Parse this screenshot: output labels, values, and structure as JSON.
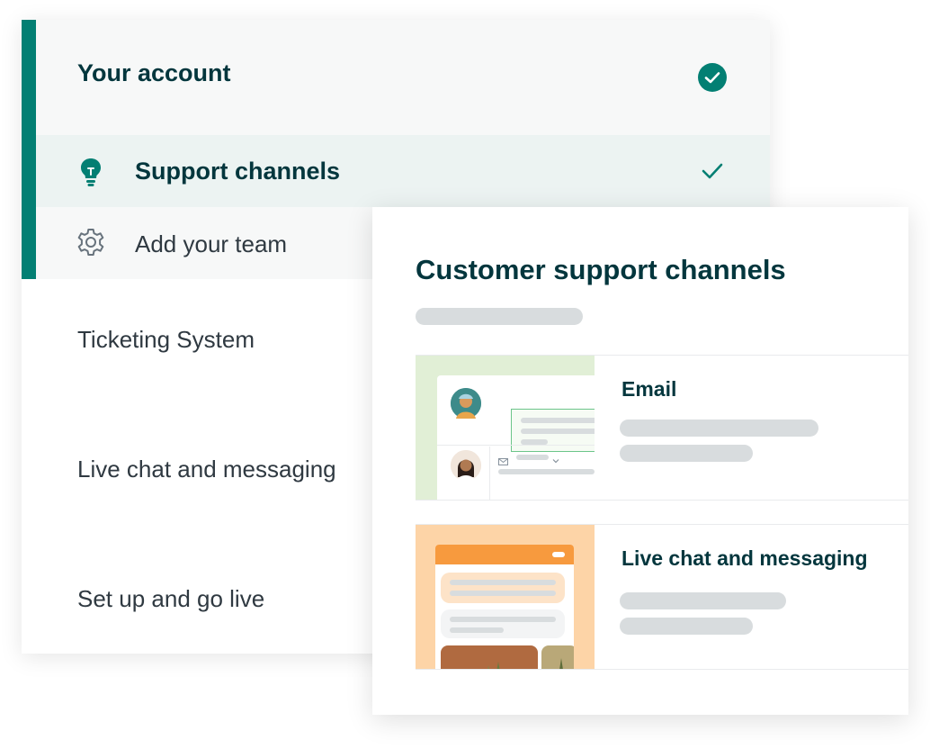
{
  "setup_steps": {
    "account": {
      "label": "Your account",
      "status_icon": "check-circle-icon"
    },
    "support": {
      "label": "Support channels",
      "icon": "lightbulb-icon",
      "status_icon": "check-icon"
    },
    "team": {
      "label": "Add your team",
      "icon": "gear-icon"
    },
    "ticketing": {
      "label": "Ticketing System"
    },
    "chat": {
      "label": "Live chat and messaging"
    },
    "golive": {
      "label": "Set up and go live"
    }
  },
  "card": {
    "title": "Customer support channels",
    "channels": [
      {
        "name": "Email",
        "thumbnail_icon": "email-preview"
      },
      {
        "name": "Live chat and messaging",
        "thumbnail_icon": "chat-preview"
      }
    ]
  },
  "colors": {
    "accent": "#037f73",
    "heading": "#03363d",
    "placeholder": "#d8dcde",
    "email_bg": "#e1efd6",
    "chat_bg": "#fdd4a7",
    "chat_header": "#f79a3e"
  }
}
